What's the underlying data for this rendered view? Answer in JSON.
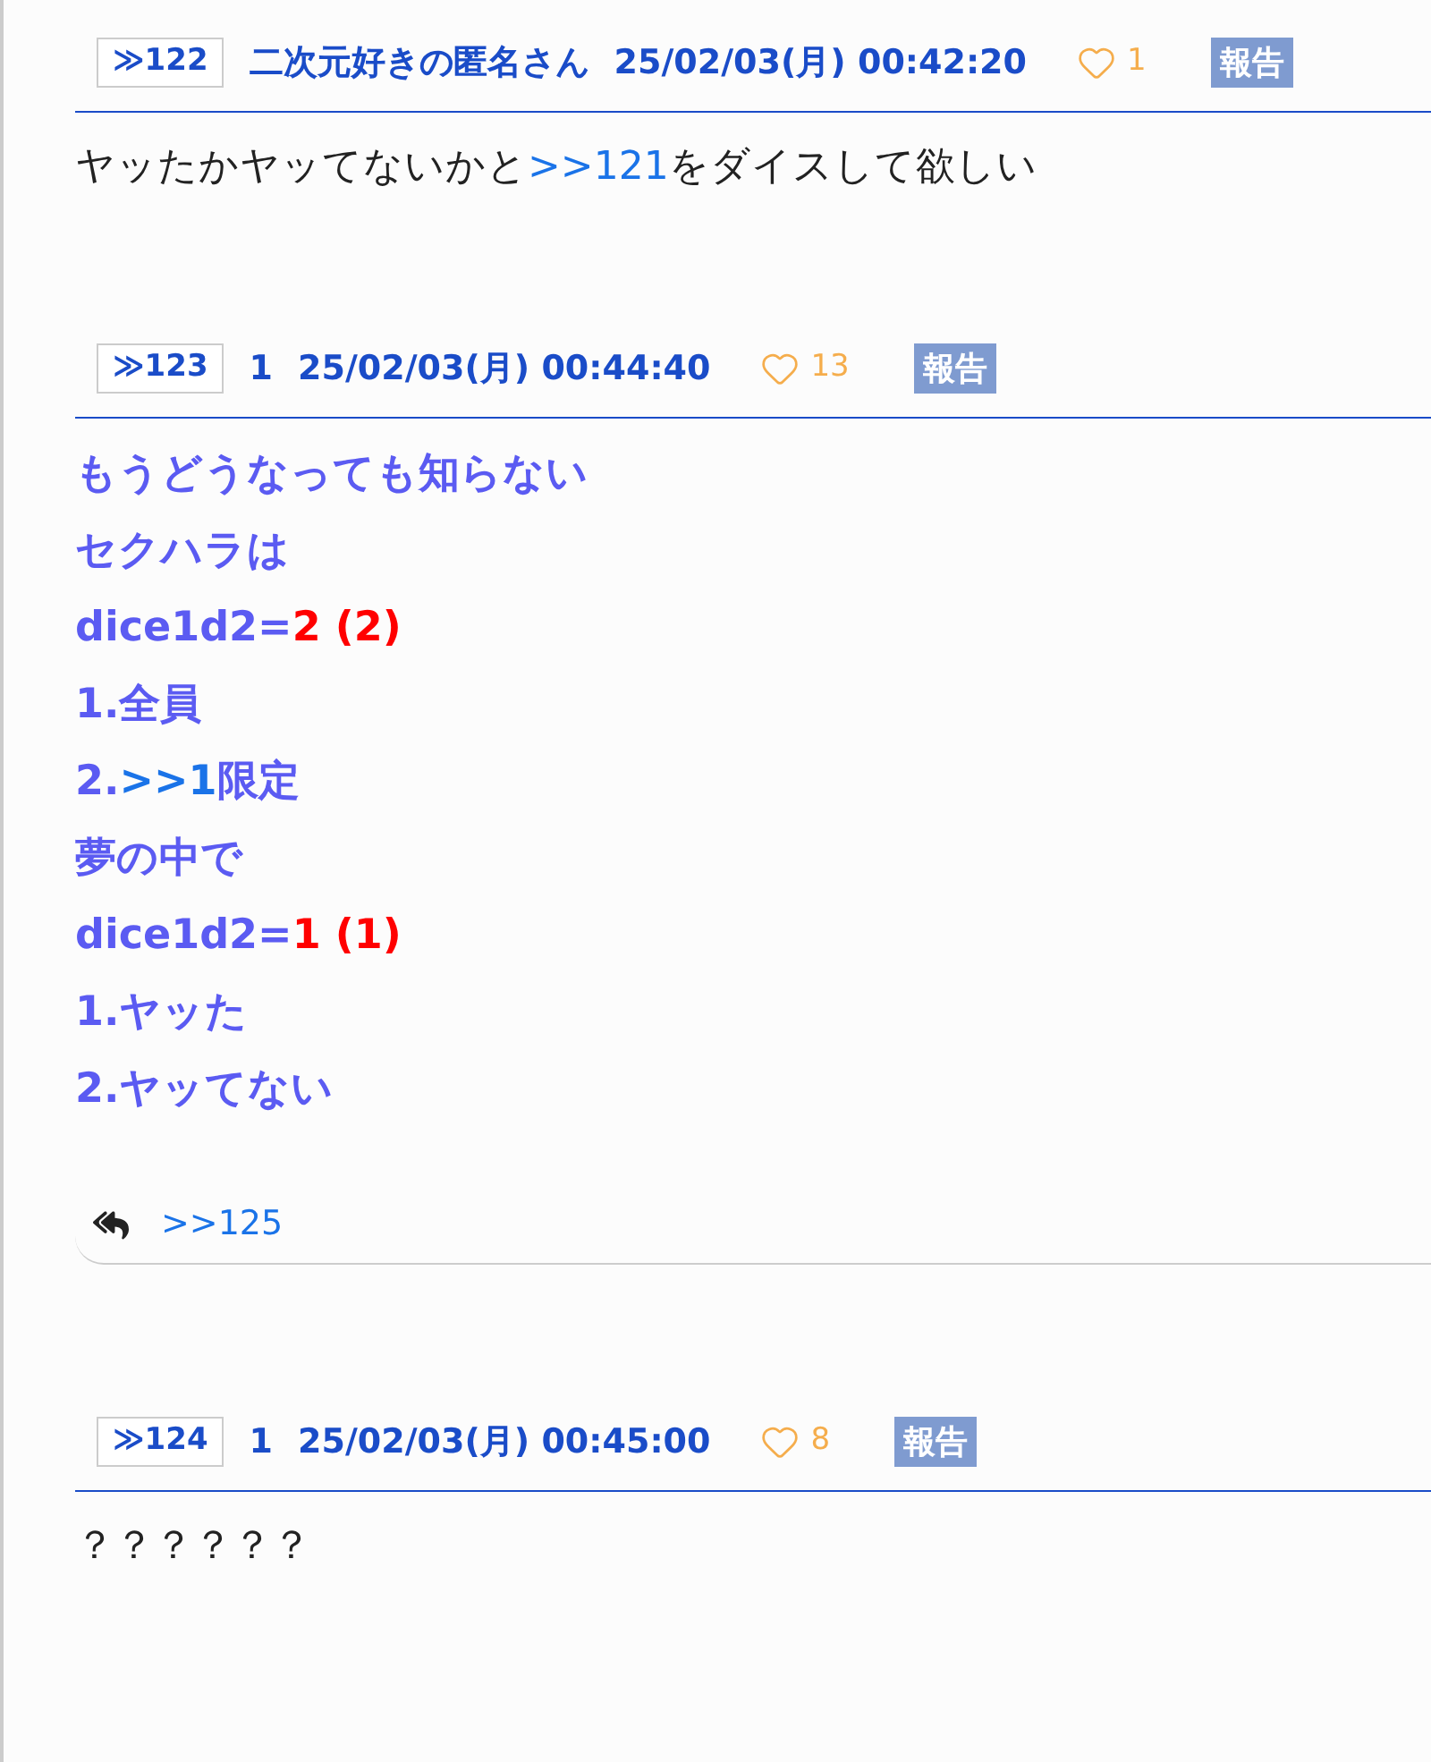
{
  "posts": [
    {
      "number": "≫122",
      "name": "二次元好きの匿名さん",
      "date": "25/02/03(月) 00:42:20",
      "likes": "1",
      "report": "報告",
      "kind": "plain",
      "lines": [
        [
          {
            "kind": "plain",
            "text": "ヤッたかヤッてないかと"
          },
          {
            "kind": "link",
            "text": ">>121"
          },
          {
            "kind": "plain",
            "text": "をダイスして欲しい"
          }
        ]
      ]
    },
    {
      "number": "≫123",
      "name": "1",
      "date": "25/02/03(月) 00:44:40",
      "likes": "13",
      "report": "報告",
      "kind": "emphasis",
      "lines": [
        [
          {
            "kind": "plain",
            "text": "もうどうなっても知らない"
          }
        ],
        [
          {
            "kind": "plain",
            "text": "セクハラは"
          }
        ],
        [
          {
            "kind": "plain",
            "text": "dice1d2="
          },
          {
            "kind": "dice",
            "text": "2 (2)"
          }
        ],
        [
          {
            "kind": "plain",
            "text": "1.全員"
          }
        ],
        [
          {
            "kind": "plain",
            "text": "2."
          },
          {
            "kind": "link",
            "text": ">>1"
          },
          {
            "kind": "plain",
            "text": "限定"
          }
        ],
        [
          {
            "kind": "plain",
            "text": "夢の中で"
          }
        ],
        [
          {
            "kind": "plain",
            "text": "dice1d2="
          },
          {
            "kind": "dice",
            "text": "1 (1)"
          }
        ],
        [
          {
            "kind": "plain",
            "text": "1.ヤッた"
          }
        ],
        [
          {
            "kind": "plain",
            "text": "2.ヤッてない"
          }
        ]
      ],
      "replies": [
        ">>125"
      ]
    },
    {
      "number": "≫124",
      "name": "1",
      "date": "25/02/03(月) 00:45:00",
      "likes": "8",
      "report": "報告",
      "kind": "plain",
      "lines": [
        [
          {
            "kind": "plain",
            "text": "？？？？？？"
          }
        ]
      ]
    }
  ]
}
